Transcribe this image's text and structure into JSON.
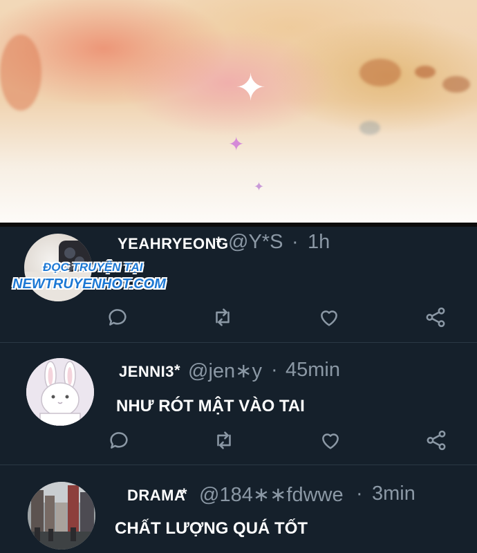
{
  "watermark": {
    "line1": "ĐỌC TRUYỆN TẠI",
    "line2": "NEWTRUYENHOT.COM"
  },
  "tweets": [
    {
      "name": "YEAHRYEONG",
      "star": "*",
      "handle": "@Y*S",
      "dot": "·",
      "time": "1h",
      "text": "",
      "avatar_icon": "phone-avatar-icon"
    },
    {
      "name": "JENNI3",
      "star": "*",
      "handle": "@jen∗y",
      "dot": "·",
      "time": "45min",
      "text": "NHƯ RÓT MẬT VÀO TAI",
      "avatar_icon": "rabbit-avatar-icon"
    },
    {
      "name": "DRAMA",
      "star": "*",
      "handle": "@184∗∗fdwwe",
      "dot": "·",
      "time": "3min",
      "text": "CHẤT LƯỢNG QUÁ TỐT",
      "avatar_icon": "city-street-avatar-icon"
    }
  ],
  "actions": [
    "reply-icon",
    "retweet-icon",
    "like-icon",
    "share-icon"
  ],
  "colors": {
    "background": "#15202b",
    "muted_text": "#8b98a5",
    "icon": "#8b98a5",
    "separator": "#2b3945",
    "watermark": "#1c78d4"
  }
}
